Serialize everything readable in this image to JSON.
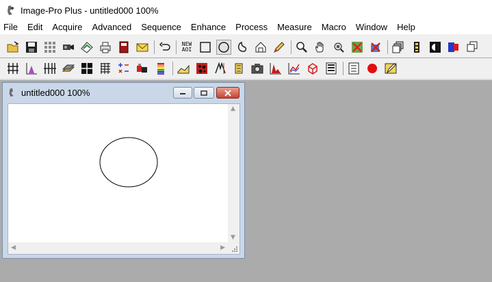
{
  "app": {
    "title": "Image-Pro Plus - untitled000 100%"
  },
  "menu": [
    "File",
    "Edit",
    "Acquire",
    "Advanced",
    "Sequence",
    "Enhance",
    "Process",
    "Measure",
    "Macro",
    "Window",
    "Help"
  ],
  "toolbar": {
    "new_aoi_label_1": "NEW",
    "new_aoi_label_2": "AOI"
  },
  "child_window": {
    "title": "untitled000 100%"
  },
  "colors": {
    "desktop": "#ababab",
    "toolbar": "#f0f0f0",
    "window_frame": "#c9d7e8",
    "close_red": "#c8432e"
  }
}
